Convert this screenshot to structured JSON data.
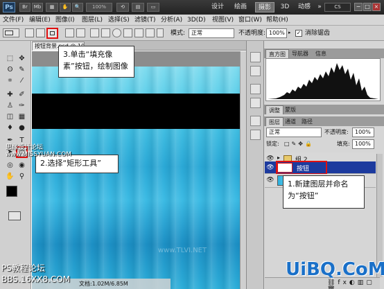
{
  "app": {
    "logo": "Ps",
    "bar_buttons": [
      "Br",
      "Mb"
    ],
    "zoom": "100%",
    "workspaces": [
      "设计",
      "绘画",
      "摄影",
      "3D",
      "动感"
    ],
    "window_controls": [
      "−",
      "□",
      "×"
    ]
  },
  "menu": [
    "文件(F)",
    "编辑(E)",
    "图像(I)",
    "图层(L)",
    "选择(S)",
    "滤镜(T)",
    "分析(A)",
    "3D(D)",
    "视图(V)",
    "窗口(W)",
    "帮助(H)"
  ],
  "options_bar": {
    "mode_label": "模式:",
    "mode_value": "正常",
    "opacity_label": "不透明度:",
    "opacity_value": "100%",
    "antialias_label": "消除锯齿",
    "antialias_checked": true
  },
  "document": {
    "tab_title": "按钮背景.psd @ 100%",
    "status": "文档:1.02M/6.85M",
    "watermark": "www.TLVI.NET"
  },
  "panels": {
    "histogram_tabs": [
      "直方图",
      "导航器",
      "信息"
    ],
    "adjust_tabs": [
      "调整",
      "蒙版"
    ],
    "layers_tabs": [
      "图层",
      "通道",
      "路径"
    ],
    "blend_mode": "正常",
    "opacity_label": "不透明度:",
    "opacity_value": "100%",
    "lock_label": "锁定:",
    "fill_label": "填充:",
    "fill_value": "100%",
    "layers": [
      {
        "name": "组 2",
        "type": "group"
      },
      {
        "name": "按钮",
        "type": "layer",
        "active": true
      },
      {
        "name": "",
        "type": "layer"
      }
    ]
  },
  "callouts": {
    "step1": "1.新建图层并命名为“按钮”",
    "step2": "2.选择“矩形工具”",
    "step3": "3.单击“填充像素”按钮，绘制图像"
  },
  "brand": {
    "missyuan": "思缘设计论坛  www.MISSYUAN.COM",
    "ps_forum": "PS教程论坛",
    "bbs": "BBS.16XX8.COM",
    "uibq": "UiBQ.CoM"
  },
  "colors": {
    "layer_selected": "#1c3a9e",
    "highlight_red": "#e01010",
    "brand_blue": "#1a70c8"
  }
}
